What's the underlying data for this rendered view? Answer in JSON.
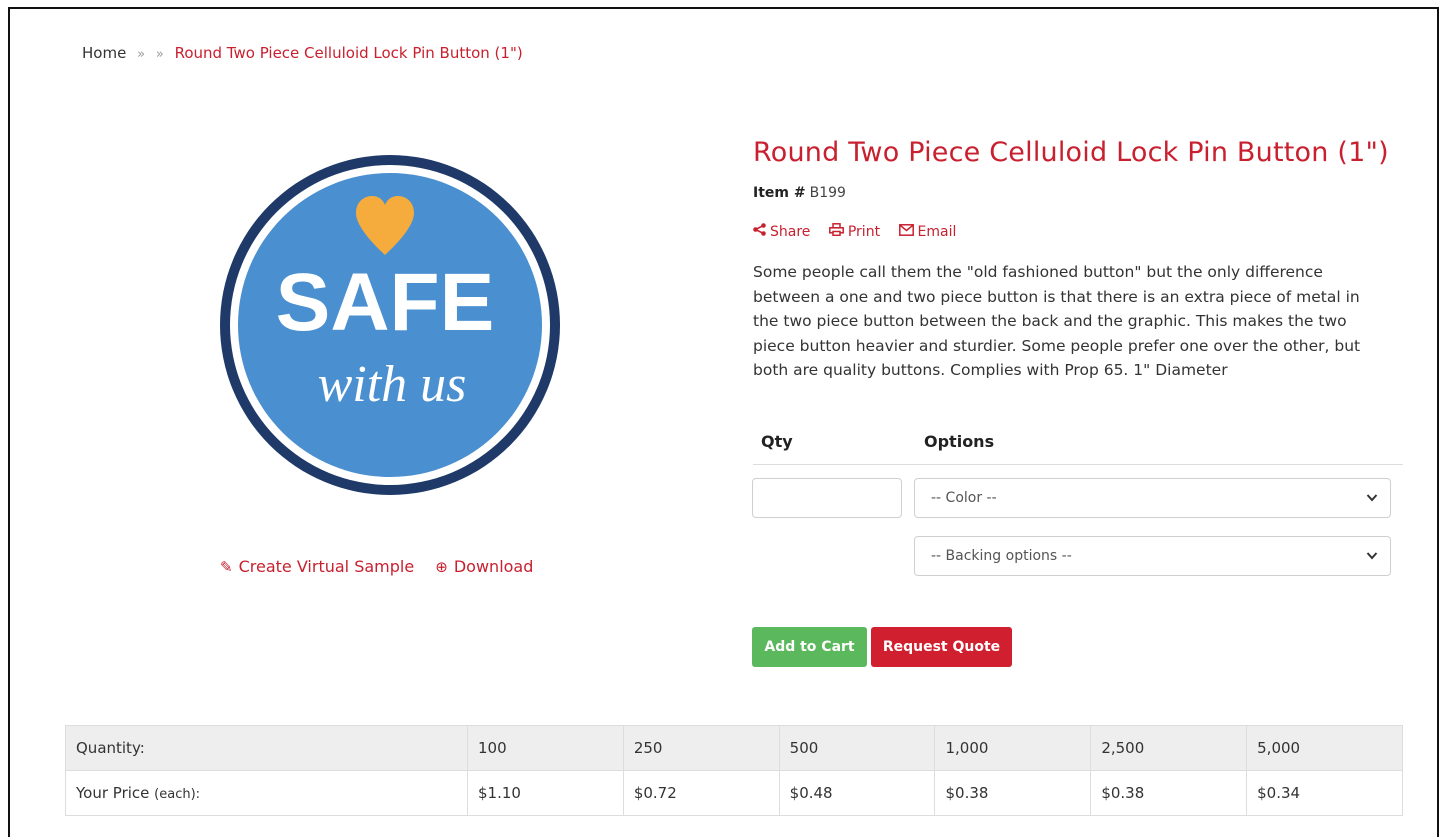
{
  "breadcrumb": {
    "home": "Home",
    "sep1": "»",
    "sep2": "»",
    "current": "Round Two Piece Celluloid Lock Pin Button (1\")"
  },
  "product_image": {
    "top_text": "SAFE",
    "bottom_text": "with us",
    "colors": {
      "ring": "#1f3a68",
      "fill": "#4a8fd0",
      "heart": "#f6ac3c"
    }
  },
  "image_links": {
    "create_sample": "Create Virtual Sample",
    "download": "Download"
  },
  "product": {
    "title": "Round Two Piece Celluloid Lock Pin Button (1\")",
    "item_label": "Item #",
    "item_number": "B199",
    "description": "Some people call them the \"old fashioned button\" but the only difference between a one and two piece button is that there is an extra piece of metal in the two piece button between the back and the graphic. This makes the two piece button heavier and sturdier. Some people prefer one over the other, but both are quality buttons. Complies with Prop 65. 1\" Diameter"
  },
  "actions": {
    "share": "Share",
    "print": "Print",
    "email": "Email"
  },
  "order_form": {
    "qty_header": "Qty",
    "options_header": "Options",
    "qty_value": "",
    "color_select": "-- Color --",
    "backing_select": "-- Backing options --",
    "add_to_cart": "Add to Cart",
    "request_quote": "Request Quote"
  },
  "price_table": {
    "quantity_label": "Quantity:",
    "price_label": "Your Price",
    "price_label_suffix": "(each):",
    "quantities": [
      "100",
      "250",
      "500",
      "1,000",
      "2,500",
      "5,000"
    ],
    "prices": [
      "$1.10",
      "$0.72",
      "$0.48",
      "$0.38",
      "$0.38",
      "$0.34"
    ]
  },
  "colors": {
    "accent_red": "#c8202f",
    "cart_green": "#5cb85c",
    "quote_red": "#d0202f"
  }
}
